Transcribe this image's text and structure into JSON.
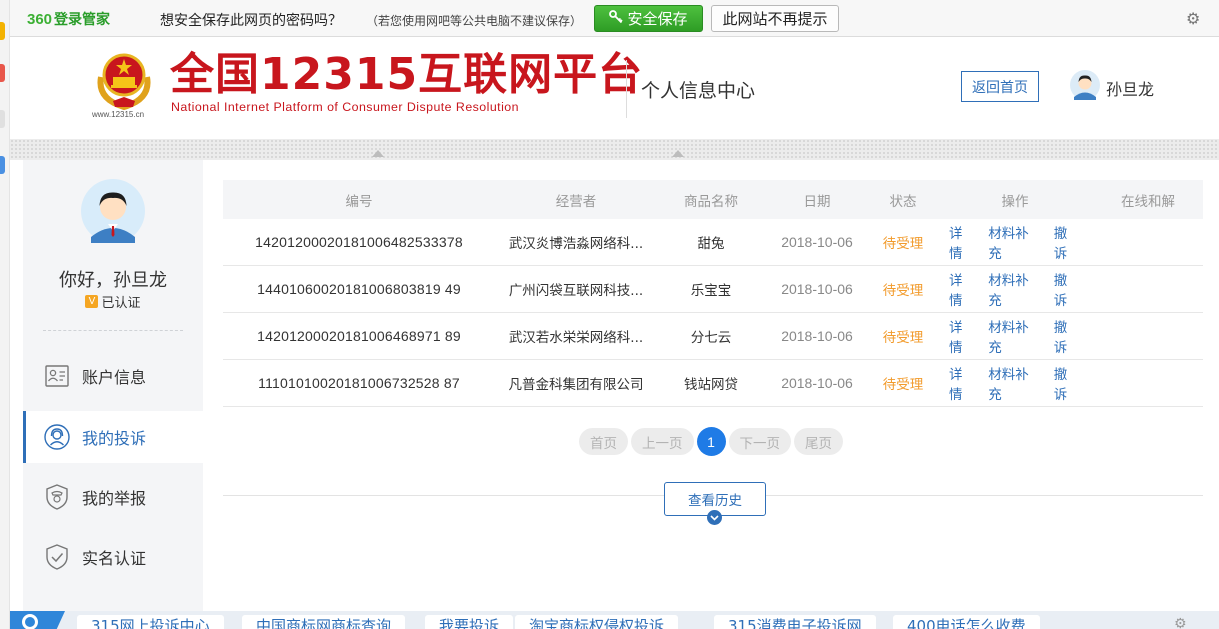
{
  "password_bar": {
    "brand_number": "360",
    "brand_label": "登录管家",
    "question": "想安全保存此网页的密码吗？",
    "note": "（若您使用网吧等公共电脑不建议保存）",
    "save_label": "安全保存",
    "dont_remind_label": "此网站不再提示"
  },
  "header": {
    "site_url": "www.12315.cn",
    "brand_cn": "全国12315互联网平台",
    "brand_en": "National Internet Platform of Consumer Dispute Resolution",
    "page_title": "个人信息中心",
    "home_button": "返回首页",
    "user_name": "孙旦龙"
  },
  "sidebar": {
    "greeting": "你好，孙旦龙",
    "cert_badge": "V",
    "cert_label": "已认证",
    "items": [
      {
        "label": "账户信息",
        "icon": "id-card-icon",
        "active": false
      },
      {
        "label": "我的投诉",
        "icon": "headset-user-icon",
        "active": true
      },
      {
        "label": "我的举报",
        "icon": "police-badge-icon",
        "active": false
      },
      {
        "label": "实名认证",
        "icon": "shield-check-icon",
        "active": false
      }
    ]
  },
  "table": {
    "headers": [
      "编号",
      "经营者",
      "商品名称",
      "日期",
      "状态",
      "操作",
      "在线和解"
    ],
    "rows": [
      {
        "id": "14201200020181006482533378",
        "merchant": "武汉炎博浩淼网络科...",
        "product": "甜兔",
        "date": "2018-10-06",
        "status": "待受理"
      },
      {
        "id": "14401060020181006803819 49",
        "merchant": "广州闪袋互联网科技...",
        "product": "乐宝宝",
        "date": "2018-10-06",
        "status": "待受理"
      },
      {
        "id": "14201200020181006468971 89",
        "merchant": "武汉若水栄栄网络科...",
        "product": "分七云",
        "date": "2018-10-06",
        "status": "待受理"
      },
      {
        "id": "11101010020181006732528 87",
        "merchant": "凡普金科集团有限公司",
        "product": "钱站网贷",
        "date": "2018-10-06",
        "status": "待受理"
      }
    ],
    "ops": [
      "详情",
      "材料补充",
      "撤诉"
    ]
  },
  "pager": {
    "first": "首页",
    "prev": "上一页",
    "current": "1",
    "next": "下一页",
    "last": "尾页"
  },
  "history_button": "查看历史",
  "bottom_links": [
    "315网上投诉中心",
    "中国商标网商标查询",
    "我要投诉",
    "淘宝商标权侵权投诉",
    "315消费电子投诉网",
    "400电话怎么收费"
  ],
  "colors": {
    "accent_blue": "#2f6fb8",
    "brand_red": "#c8161d",
    "status_orange": "#f29b2c",
    "save_green": "#3cb034"
  }
}
